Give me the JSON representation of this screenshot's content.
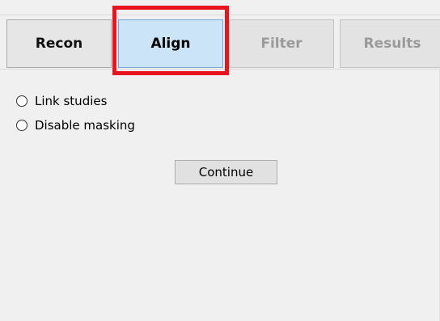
{
  "tabs": [
    {
      "label": "Recon",
      "state": "normal"
    },
    {
      "label": "Align",
      "state": "active"
    },
    {
      "label": "Filter",
      "state": "disabled"
    },
    {
      "label": "Results",
      "state": "disabled"
    }
  ],
  "options": [
    {
      "label": "Link studies",
      "selected": false
    },
    {
      "label": "Disable masking",
      "selected": false
    }
  ],
  "continue_label": "Continue",
  "colors": {
    "highlight": "#e8141e",
    "active_tab": "#cce4f7",
    "disabled_text": "#9a9a9a"
  }
}
